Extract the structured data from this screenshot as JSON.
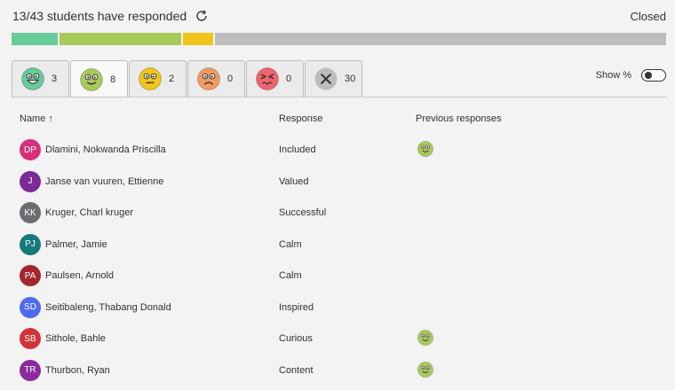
{
  "header": {
    "title": "13/43 students have responded",
    "status": "Closed"
  },
  "progress": [
    {
      "fraction": 0.07,
      "color": "#66cc99"
    },
    {
      "fraction": 0.186,
      "color": "#a9c95a"
    },
    {
      "fraction": 0.047,
      "color": "#f0c419"
    },
    {
      "fraction": 0.0,
      "color": "#f29a60"
    },
    {
      "fraction": 0.0,
      "color": "#f0646e"
    },
    {
      "fraction": 0.697,
      "color": "#bdbdbd"
    }
  ],
  "tabs": [
    {
      "icon": "very-happy-face-icon",
      "count": "3",
      "color": "#66cc99",
      "active": false
    },
    {
      "icon": "happy-face-icon",
      "count": "8",
      "color": "#a9c95a",
      "active": true
    },
    {
      "icon": "neutral-face-icon",
      "count": "2",
      "color": "#f0c419",
      "active": false
    },
    {
      "icon": "sad-face-icon",
      "count": "0",
      "color": "#f29a60",
      "active": false
    },
    {
      "icon": "very-sad-face-icon",
      "count": "0",
      "color": "#f0646e",
      "active": false
    },
    {
      "icon": "no-response-icon",
      "count": "30",
      "color": "#bdbdbd",
      "active": false
    }
  ],
  "show_percent": {
    "label": "Show %",
    "enabled": false
  },
  "columns": {
    "name": "Name ↑",
    "response": "Response",
    "previous": "Previous responses"
  },
  "students": [
    {
      "initials": "DP",
      "name": "Dlamini, Nokwanda Priscilla",
      "response": "Included",
      "avatar_color": "#d6307a",
      "previous": "happy-face-icon"
    },
    {
      "initials": "J",
      "name": "Janse van vuuren, Ettienne",
      "response": "Valued",
      "avatar_color": "#7b2a96",
      "previous": ""
    },
    {
      "initials": "KK",
      "name": "Kruger, Charl kruger",
      "response": "Successful",
      "avatar_color": "#6a6e72",
      "previous": ""
    },
    {
      "initials": "PJ",
      "name": "Palmer, Jamie",
      "response": "Calm",
      "avatar_color": "#147a7a",
      "previous": ""
    },
    {
      "initials": "PA",
      "name": "Paulsen, Arnold",
      "response": "Calm",
      "avatar_color": "#a4262c",
      "previous": ""
    },
    {
      "initials": "SD",
      "name": "Seitibaleng, Thabang Donald",
      "response": "Inspired",
      "avatar_color": "#4f6bed",
      "previous": ""
    },
    {
      "initials": "SB",
      "name": "Sithole, Bahle",
      "response": "Curious",
      "avatar_color": "#d13438",
      "previous": "happy-face-icon"
    },
    {
      "initials": "TR",
      "name": "Thurbon, Ryan",
      "response": "Content",
      "avatar_color": "#8a2a9e",
      "previous": "happy-face-icon"
    }
  ]
}
